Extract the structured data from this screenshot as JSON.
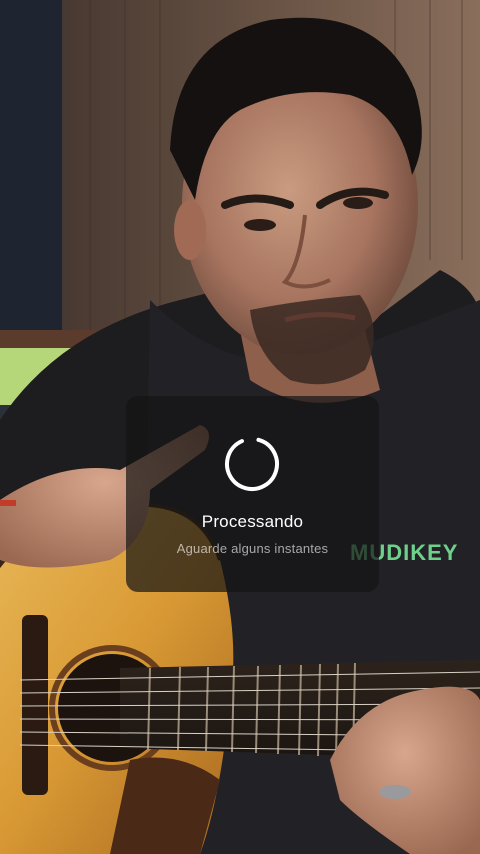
{
  "loading": {
    "title": "Processando",
    "subtitle": "Aguarde alguns instantes",
    "spinner_icon": "loading-spinner-icon"
  },
  "video": {
    "shirt_text": "MUDIKEY"
  },
  "colors": {
    "overlay_bg": "#141414",
    "title_text": "#ffffff",
    "subtitle_text": "#a0a0a0",
    "shirt_print": "#6fd08c"
  }
}
